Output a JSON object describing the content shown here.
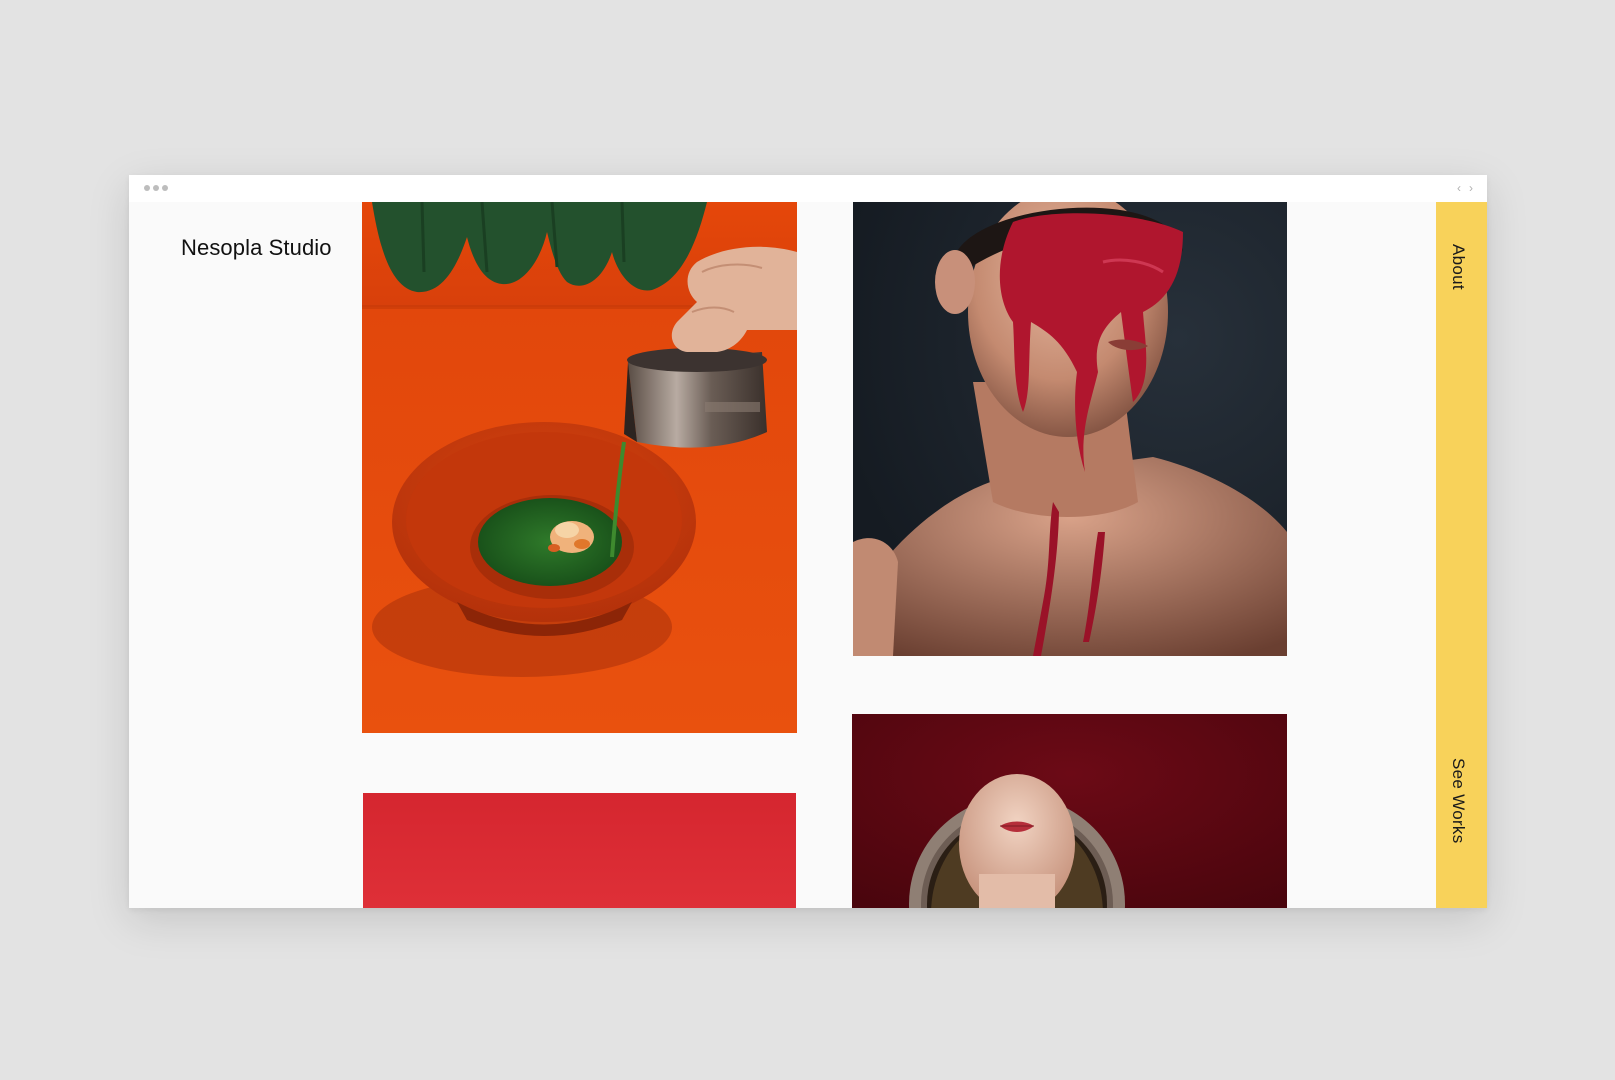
{
  "site": {
    "brand": "Nesopla Studio"
  },
  "browser": {
    "back_glyph": "‹",
    "forward_glyph": "›"
  },
  "sidebar": {
    "about": "About",
    "see_works": "See Works"
  },
  "colors": {
    "accent_yellow": "#f8d25a",
    "page_background": "#fafafa",
    "backdrop": "#e3e3e3"
  },
  "gallery": [
    {
      "subject": "bowl-of-green-soup-pouring"
    },
    {
      "subject": "man-with-red-paint-on-face"
    },
    {
      "subject": "red-backdrop"
    },
    {
      "subject": "woman-framed-in-ring"
    }
  ]
}
